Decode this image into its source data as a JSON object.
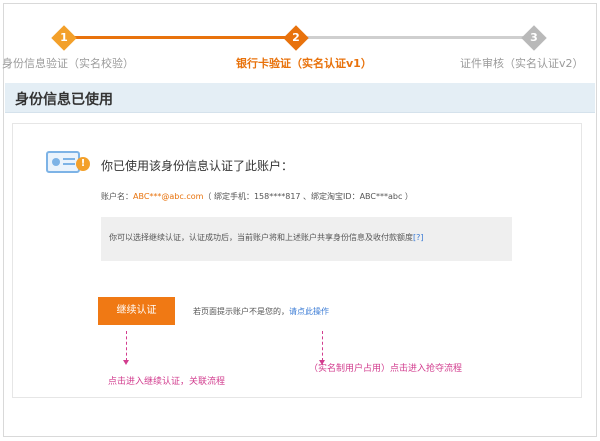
{
  "steps": [
    {
      "number": "1",
      "label": "身份信息验证（实名校验）"
    },
    {
      "number": "2",
      "label": "银行卡验证（实名认证v1）"
    },
    {
      "number": "3",
      "label": "证件审核（实名认证v2）"
    }
  ],
  "header": {
    "title": "身份信息已使用"
  },
  "card": {
    "warn_glyph": "!",
    "message": "你已使用该身份信息认证了此账户：",
    "account_prefix": "账户名：",
    "account_email": "ABC***@abc.com",
    "account_suffix": "（ 绑定手机：158****817 、绑定淘宝ID：ABC***abc ）",
    "notice_text": "你可以选择继续认证，认证成功后，当前账户将和上述账户共享身份信息及收付款额度",
    "notice_help": "[?]",
    "continue_button": "继续认证",
    "hint_text": "若页面提示账户不是您的，",
    "hint_link": "请点此操作"
  },
  "annotations": {
    "left": "点击进入继续认证，关联流程",
    "right": "（实名制用户占用）点击进入抢夺流程"
  },
  "colors": {
    "accent": "#e8720c",
    "annotation": "#d23c8e",
    "link": "#3a7bd5"
  }
}
